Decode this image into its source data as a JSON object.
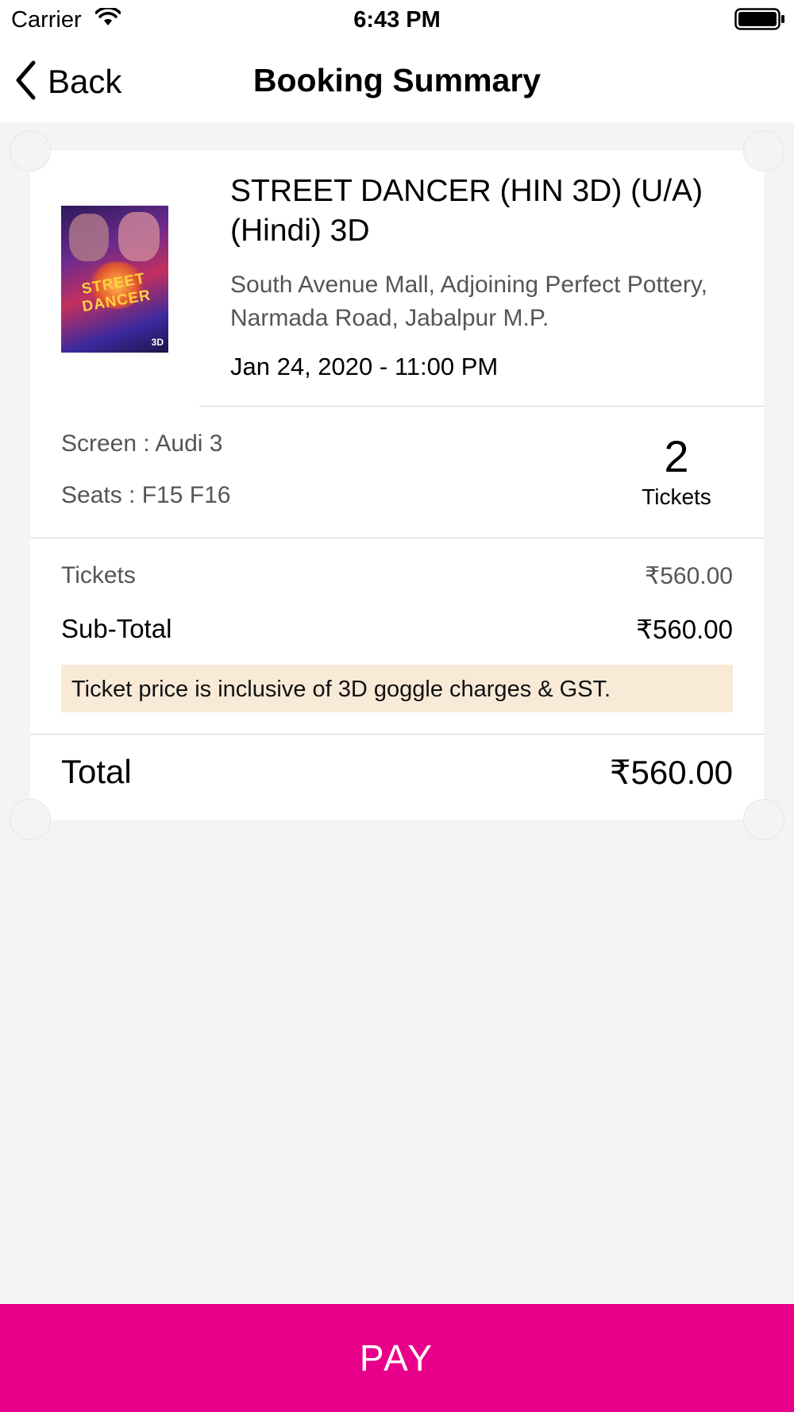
{
  "status_bar": {
    "carrier": "Carrier",
    "time": "6:43 PM",
    "icons": [
      "wifi-icon",
      "battery-icon"
    ]
  },
  "nav": {
    "back_label": "Back",
    "title": "Booking Summary"
  },
  "booking": {
    "movie_title": "STREET DANCER (HIN 3D) (U/A) (Hindi) 3D",
    "venue": "South Avenue Mall, Adjoining Perfect Pottery, Narmada Road, Jabalpur M.P.",
    "showtime": "Jan 24, 2020 - 11:00 PM",
    "poster": {
      "alt": "Street Dancer 3D movie poster",
      "logo_text": "STREET DANCER",
      "badge": "3D"
    },
    "screen": "Screen : Audi 3",
    "seats": "Seats : F15 F16",
    "ticket_count": "2",
    "ticket_unit": "Tickets"
  },
  "pricing": {
    "tickets_label": "Tickets",
    "tickets_value": "₹560.00",
    "subtotal_label": "Sub-Total",
    "subtotal_value": "₹560.00",
    "notice": "Ticket price is inclusive of 3D goggle charges & GST.",
    "total_label": "Total",
    "total_value": "₹560.00"
  },
  "actions": {
    "pay_label": "PAY"
  },
  "colors": {
    "accent": "#e8008b",
    "notice_bg": "#f9ead8",
    "page_bg": "#f4f4f4"
  }
}
